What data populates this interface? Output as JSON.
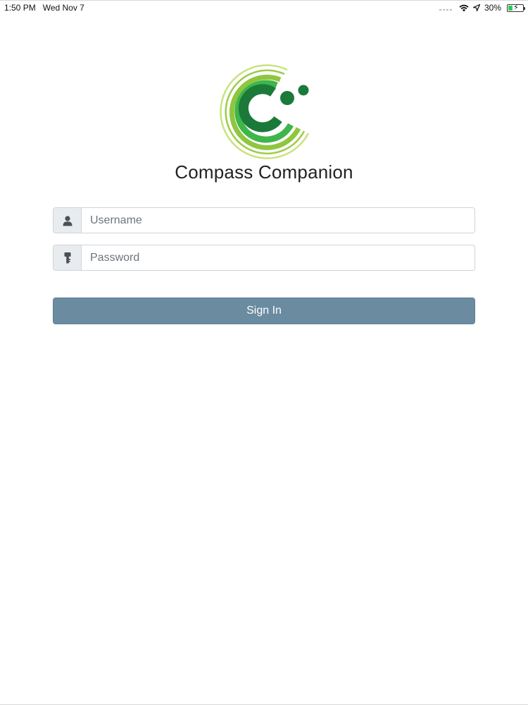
{
  "status_bar": {
    "time": "1:50 PM",
    "date": "Wed Nov 7",
    "battery_percent": "30%",
    "battery_level": 0.3,
    "battery_charging": true
  },
  "app": {
    "title": "Compass Companion",
    "logo_icon": "compass-companion-logo",
    "colors": {
      "dark_green": "#1b7a3a",
      "mid_green": "#3fb54a",
      "light_green": "#8fc63f",
      "pale_green": "#c5e07a",
      "button": "#6a8ba0"
    }
  },
  "login_form": {
    "username": {
      "icon": "user-icon",
      "placeholder": "Username",
      "value": ""
    },
    "password": {
      "icon": "key-icon",
      "placeholder": "Password",
      "value": ""
    },
    "sign_in_label": "Sign In"
  }
}
